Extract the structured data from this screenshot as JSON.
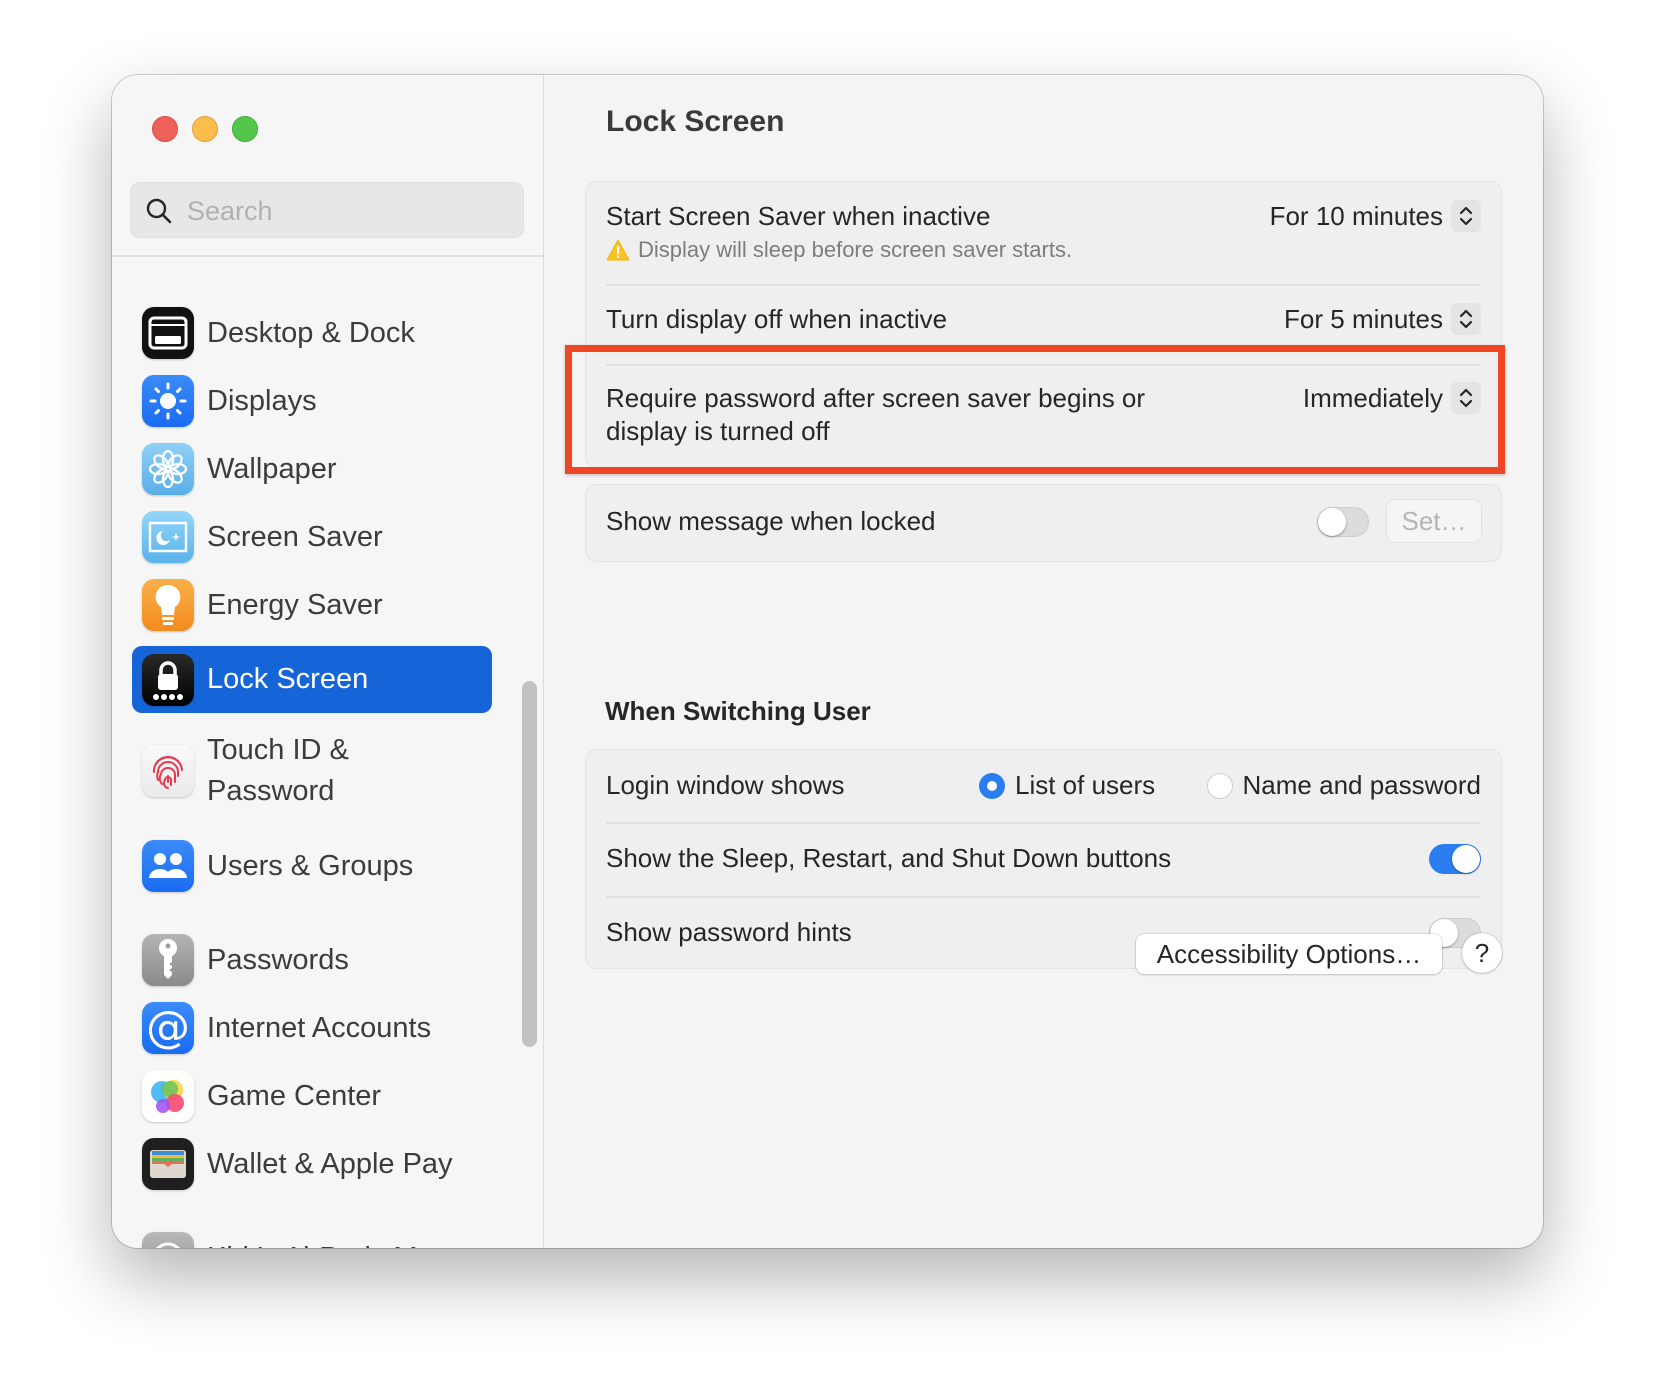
{
  "window": {
    "traffic_lights": [
      "close",
      "minimize",
      "zoom"
    ]
  },
  "sidebar": {
    "search": {
      "placeholder": "Search",
      "value": ""
    },
    "items": [
      {
        "label": "Desktop & Dock",
        "icon": "desktop-dock-icon",
        "selected": false
      },
      {
        "label": "Displays",
        "icon": "displays-icon",
        "selected": false
      },
      {
        "label": "Wallpaper",
        "icon": "wallpaper-icon",
        "selected": false
      },
      {
        "label": "Screen Saver",
        "icon": "screen-saver-icon",
        "selected": false
      },
      {
        "label": "Energy Saver",
        "icon": "energy-saver-icon",
        "selected": false
      },
      {
        "label": "Lock Screen",
        "icon": "lock-screen-icon",
        "selected": true
      },
      {
        "label": "Touch ID &\nPassword",
        "line1": "Touch ID &",
        "line2": "Password",
        "icon": "touch-id-icon",
        "selected": false
      },
      {
        "label": "Users & Groups",
        "icon": "users-groups-icon",
        "selected": false
      },
      {
        "label": "Passwords",
        "icon": "passwords-key-icon",
        "selected": false
      },
      {
        "label": "Internet Accounts",
        "icon": "internet-accounts-icon",
        "selected": false
      },
      {
        "label": "Game Center",
        "icon": "game-center-icon",
        "selected": false
      },
      {
        "label": "Wallet & Apple Pay",
        "icon": "wallet-icon",
        "selected": false
      },
      {
        "label": "Kirk’s AirPods Max",
        "icon": "airpods-max-icon",
        "selected": false
      }
    ],
    "accent_color": "#1565d8"
  },
  "main": {
    "title": "Lock Screen",
    "group1": {
      "rows": [
        {
          "label": "Start Screen Saver when inactive",
          "value": "For 10 minutes",
          "warning": "Display will sleep before screen saver starts."
        },
        {
          "label": "Turn display off when inactive",
          "value": "For 5 minutes"
        },
        {
          "label_line1": "Require password after screen saver begins or",
          "label_line2": "display is turned off",
          "value": "Immediately",
          "highlighted": true
        }
      ]
    },
    "group2": {
      "label": "Show message when locked",
      "toggle_on": false,
      "set_button": "Set…"
    },
    "switching": {
      "title": "When Switching User",
      "login_label": "Login window shows",
      "options": [
        {
          "label": "List of users",
          "checked": true
        },
        {
          "label": "Name and password",
          "checked": false
        }
      ],
      "sleep_restart_label": "Show the Sleep, Restart, and Shut Down buttons",
      "sleep_restart_on": true,
      "hints_label": "Show password hints",
      "hints_on": false
    },
    "accessibility_button": "Accessibility Options…",
    "help_button": "?",
    "highlight_color": "#ef4626",
    "toggle_on_color": "#2a7ef0"
  }
}
